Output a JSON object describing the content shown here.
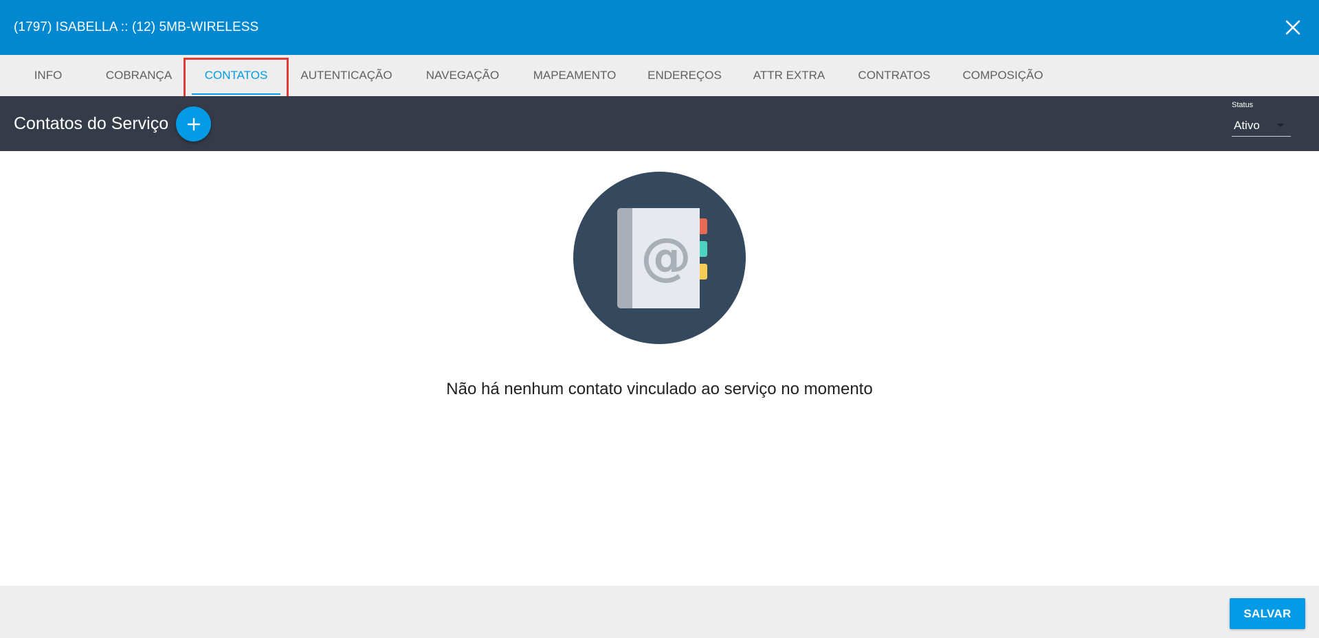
{
  "dialog": {
    "title": "(1797) ISABELLA :: (12) 5MB-WIRELESS",
    "close_icon": "close-icon",
    "accent_color": "#0288d1"
  },
  "tabs": [
    {
      "label": "INFO",
      "active": false
    },
    {
      "label": "COBRANÇA",
      "active": false
    },
    {
      "label": "CONTATOS",
      "active": true
    },
    {
      "label": "AUTENTICAÇÃO",
      "active": false
    },
    {
      "label": "NAVEGAÇÃO",
      "active": false
    },
    {
      "label": "MAPEAMENTO",
      "active": false
    },
    {
      "label": "ENDEREÇOS",
      "active": false
    },
    {
      "label": "ATTR EXTRA",
      "active": false
    },
    {
      "label": "CONTRATOS",
      "active": false
    },
    {
      "label": "COMPOSIÇÃO",
      "active": false
    }
  ],
  "section": {
    "title": "Contatos do Serviço",
    "add_icon": "plus-icon",
    "status": {
      "label": "Status",
      "value": "Ativo"
    }
  },
  "empty_state": {
    "icon": "address-book-icon",
    "message": "Não há nenhum contato vinculado ao serviço no momento"
  },
  "footer": {
    "save_label": "SALVAR"
  }
}
